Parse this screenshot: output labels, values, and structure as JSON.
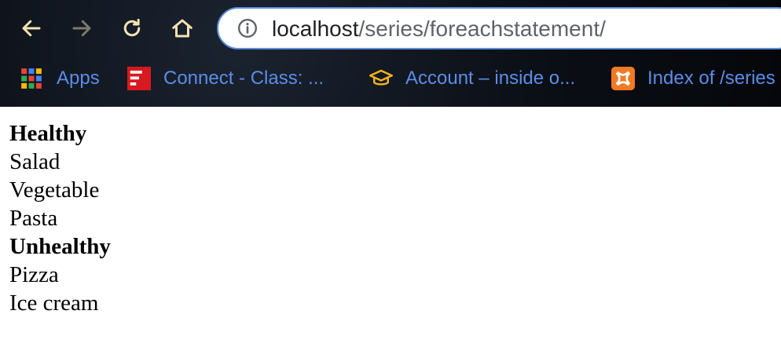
{
  "browser": {
    "url_host": "localhost",
    "url_path": "/series/foreachstatement/"
  },
  "bookmarks": [
    {
      "label": "Apps"
    },
    {
      "label": "Connect - Class: ..."
    },
    {
      "label": "Account – inside o..."
    },
    {
      "label": "Index of /series"
    }
  ],
  "page": {
    "sections": [
      {
        "heading": "Healthy",
        "items": [
          "Salad",
          "Vegetable",
          "Pasta"
        ]
      },
      {
        "heading": "Unhealthy",
        "items": [
          "Pizza",
          "Ice cream"
        ]
      }
    ]
  },
  "colors": {
    "link": "#5b8de8",
    "omnibox_border": "#5b8fd8",
    "nav_icon": "#f2e3b3"
  },
  "icons": {
    "back": "arrow-left-icon",
    "forward": "arrow-right-icon",
    "reload": "reload-icon",
    "home": "home-icon",
    "info": "info-icon"
  }
}
